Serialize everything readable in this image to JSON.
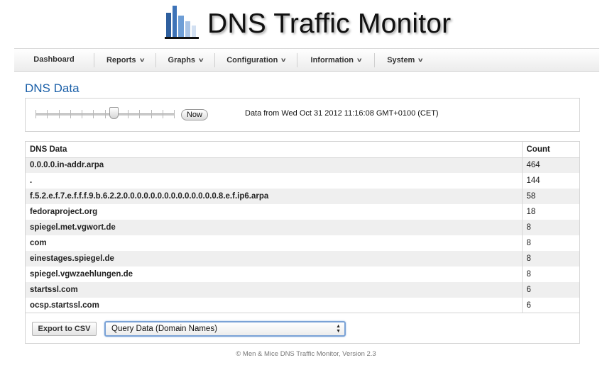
{
  "header": {
    "title": "DNS Traffic Monitor"
  },
  "nav": {
    "items": [
      {
        "label": "Dashboard",
        "has_menu": false
      },
      {
        "label": "Reports",
        "has_menu": true
      },
      {
        "label": "Graphs",
        "has_menu": true
      },
      {
        "label": "Configuration",
        "has_menu": true
      },
      {
        "label": "Information",
        "has_menu": true
      },
      {
        "label": "System",
        "has_menu": true
      }
    ],
    "chevron_icon": "chevron-down-icon"
  },
  "page": {
    "title": "DNS Data"
  },
  "controls": {
    "slider_value_fraction": 0.56,
    "now_label": "Now",
    "data_from": "Data from Wed Oct 31 2012 11:16:08 GMT+0100 (CET)"
  },
  "table": {
    "headers": {
      "name": "DNS Data",
      "count": "Count"
    },
    "rows": [
      {
        "name": "0.0.0.0.in-addr.arpa",
        "count": "464"
      },
      {
        "name": ".",
        "count": "144"
      },
      {
        "name": "f.5.2.e.f.7.e.f.f.f.9.b.6.2.2.0.0.0.0.0.0.0.0.0.0.0.0.0.0.8.e.f.ip6.arpa",
        "count": "58"
      },
      {
        "name": "fedoraproject.org",
        "count": "18"
      },
      {
        "name": "spiegel.met.vgwort.de",
        "count": "8"
      },
      {
        "name": "com",
        "count": "8"
      },
      {
        "name": "einestages.spiegel.de",
        "count": "8"
      },
      {
        "name": "spiegel.vgwzaehlungen.de",
        "count": "8"
      },
      {
        "name": "startssl.com",
        "count": "6"
      },
      {
        "name": "ocsp.startssl.com",
        "count": "6"
      }
    ]
  },
  "actions": {
    "export_label": "Export to CSV",
    "query_select_value": "Query Data (Domain Names)"
  },
  "footer": {
    "text": "© Men & Mice DNS Traffic Monitor, Version 2.3"
  },
  "colors": {
    "title_blue": "#1a5fa8",
    "row_stripe": "#efefef",
    "logo_blue": "#3d73b8"
  }
}
